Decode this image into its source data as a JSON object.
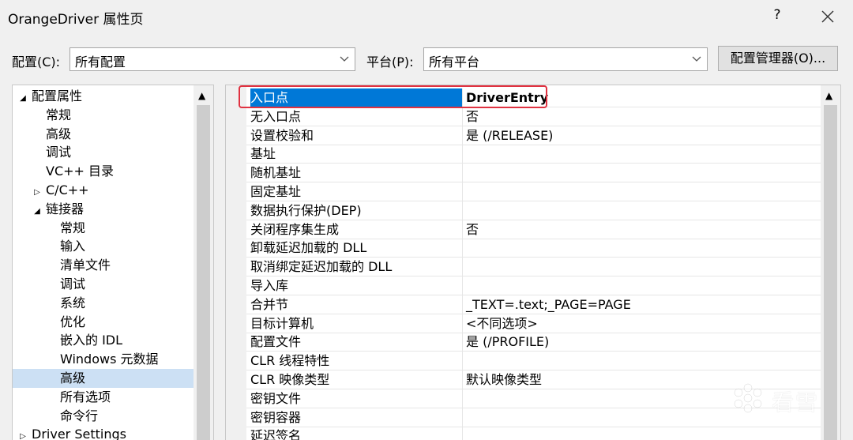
{
  "window": {
    "title": "OrangeDriver 属性页",
    "help_glyph": "?",
    "close_icon": "close-icon"
  },
  "toolbar": {
    "config_label": "配置(C):",
    "config_value": "所有配置",
    "platform_label": "平台(P):",
    "platform_value": "所有平台",
    "manager_button": "配置管理器(O)..."
  },
  "tree": {
    "items": [
      {
        "label": "配置属性",
        "level": 0,
        "toggle": "▲"
      },
      {
        "label": "常规",
        "level": 1
      },
      {
        "label": "高级",
        "level": 1
      },
      {
        "label": "调试",
        "level": 1
      },
      {
        "label": "VC++ 目录",
        "level": 1
      },
      {
        "label": "C/C++",
        "level": 1,
        "toggle": "▷"
      },
      {
        "label": "链接器",
        "level": 1,
        "toggle": "▲"
      },
      {
        "label": "常规",
        "level": 2
      },
      {
        "label": "输入",
        "level": 2
      },
      {
        "label": "清单文件",
        "level": 2
      },
      {
        "label": "调试",
        "level": 2
      },
      {
        "label": "系统",
        "level": 2
      },
      {
        "label": "优化",
        "level": 2
      },
      {
        "label": "嵌入的 IDL",
        "level": 2
      },
      {
        "label": "Windows 元数据",
        "level": 2
      },
      {
        "label": "高级",
        "level": 2,
        "selected": true
      },
      {
        "label": "所有选项",
        "level": 2
      },
      {
        "label": "命令行",
        "level": 2
      },
      {
        "label": "Driver Settings",
        "level": 0,
        "toggle": "▷"
      }
    ]
  },
  "grid": {
    "rows": [
      {
        "name": "入口点",
        "value": "DriverEntry",
        "selected": true
      },
      {
        "name": "无入口点",
        "value": "否"
      },
      {
        "name": "设置校验和",
        "value": "是 (/RELEASE)"
      },
      {
        "name": "基址",
        "value": ""
      },
      {
        "name": "随机基址",
        "value": ""
      },
      {
        "name": "固定基址",
        "value": ""
      },
      {
        "name": "数据执行保护(DEP)",
        "value": ""
      },
      {
        "name": "关闭程序集生成",
        "value": "否"
      },
      {
        "name": "卸载延迟加载的 DLL",
        "value": ""
      },
      {
        "name": "取消绑定延迟加载的 DLL",
        "value": ""
      },
      {
        "name": "导入库",
        "value": ""
      },
      {
        "name": "合并节",
        "value": "_TEXT=.text;_PAGE=PAGE"
      },
      {
        "name": "目标计算机",
        "value": "<不同选项>"
      },
      {
        "name": "配置文件",
        "value": "是 (/PROFILE)"
      },
      {
        "name": "CLR 线程特性",
        "value": ""
      },
      {
        "name": "CLR 映像类型",
        "value": "默认映像类型"
      },
      {
        "name": "密钥文件",
        "value": ""
      },
      {
        "name": "密钥容器",
        "value": ""
      },
      {
        "name": "延迟签名",
        "value": ""
      }
    ]
  },
  "watermark": {
    "text": "看雪",
    "icon": "snowflake-icon"
  },
  "colors": {
    "selection_blue": "#0078d7",
    "tree_selection": "#cce0f4",
    "highlight_red": "#e03241"
  }
}
